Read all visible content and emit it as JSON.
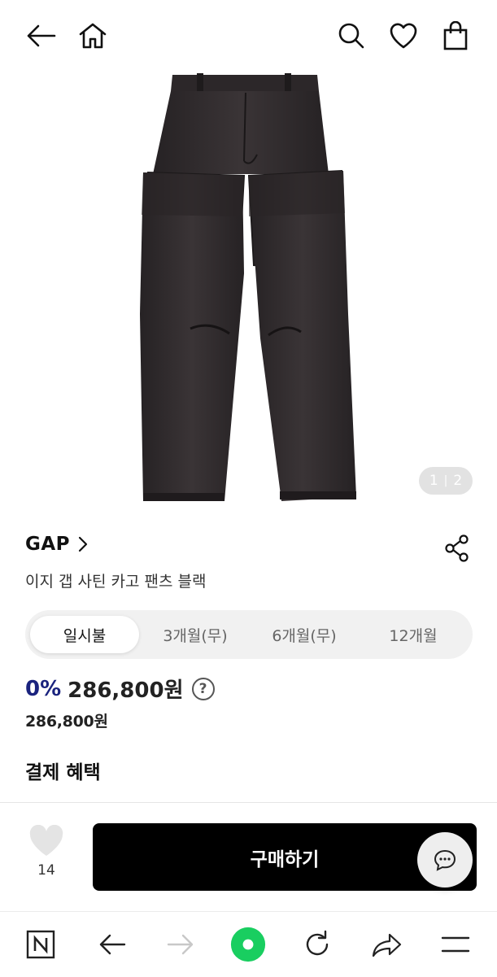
{
  "header": {
    "back_icon": "back-arrow-icon",
    "home_icon": "home-icon",
    "search_icon": "search-icon",
    "wishlist_icon": "heart-icon",
    "cart_icon": "shopping-bag-icon"
  },
  "gallery": {
    "current": "1",
    "total": "2",
    "image": "black-cargo-pants"
  },
  "product": {
    "brand": "GAP",
    "title": "이지 갭 사틴 카고 팬츠 블랙"
  },
  "installment_tabs": [
    {
      "label": "일시불",
      "active": true
    },
    {
      "label": "3개월(무)",
      "active": false
    },
    {
      "label": "6개월(무)",
      "active": false
    },
    {
      "label": "12개월",
      "active": false
    }
  ],
  "price": {
    "rate": "0%",
    "amount": "286,800원",
    "help": "?",
    "original": "286,800원"
  },
  "benefits": {
    "heading": "결제 혜택"
  },
  "actions": {
    "like_count": "14",
    "buy_label": "구매하기"
  },
  "colors": {
    "rate": "#1a237e",
    "buy_button": "#000000",
    "green_home": "#19ce60"
  }
}
